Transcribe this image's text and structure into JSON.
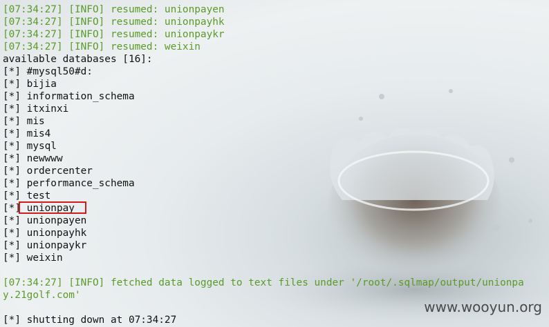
{
  "terminal": {
    "lines": [
      {
        "text": "[07:34:27] [INFO] resumed: unionpayen",
        "kind": "info"
      },
      {
        "text": "[07:34:27] [INFO] resumed: unionpayhk",
        "kind": "info"
      },
      {
        "text": "[07:34:27] [INFO] resumed: unionpaykr",
        "kind": "info"
      },
      {
        "text": "[07:34:27] [INFO] resumed: weixin",
        "kind": "info"
      },
      {
        "text": "available databases [16]:",
        "kind": "plain"
      },
      {
        "text": "[*] #mysql50#d:",
        "kind": "plain"
      },
      {
        "text": "[*] bijia",
        "kind": "plain"
      },
      {
        "text": "[*] information_schema",
        "kind": "plain"
      },
      {
        "text": "[*] itxinxi",
        "kind": "plain"
      },
      {
        "text": "[*] mis",
        "kind": "plain"
      },
      {
        "text": "[*] mis4",
        "kind": "plain"
      },
      {
        "text": "[*] mysql",
        "kind": "plain"
      },
      {
        "text": "[*] newwww",
        "kind": "plain"
      },
      {
        "text": "[*] ordercenter",
        "kind": "plain"
      },
      {
        "text": "[*] performance_schema",
        "kind": "plain"
      },
      {
        "text": "[*] test",
        "kind": "plain"
      },
      {
        "text": "[*] unionpay",
        "kind": "plain"
      },
      {
        "text": "[*] unionpayen",
        "kind": "plain"
      },
      {
        "text": "[*] unionpayhk",
        "kind": "plain"
      },
      {
        "text": "[*] unionpaykr",
        "kind": "plain"
      },
      {
        "text": "[*] weixin",
        "kind": "plain"
      },
      {
        "text": "",
        "kind": "plain"
      },
      {
        "text": "[07:34:27] [INFO] fetched data logged to text files under '/root/.sqlmap/output/unionpa",
        "kind": "info"
      },
      {
        "text": "y.21golf.com'",
        "kind": "info"
      },
      {
        "text": "",
        "kind": "plain"
      },
      {
        "text": "[*] shutting down at 07:34:27",
        "kind": "plain"
      }
    ]
  },
  "watermark": "www.wooyun.org",
  "colors": {
    "info_text": "#5a9a2a",
    "plain_text": "#111111",
    "highlight_box": "#d11b1b"
  }
}
